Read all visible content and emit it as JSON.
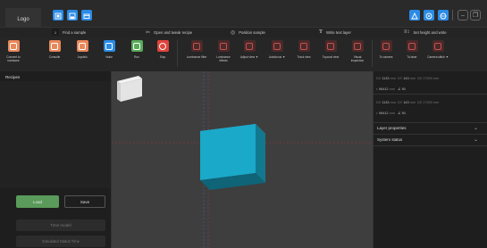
{
  "titlebar": {
    "logo": "Logo",
    "window_controls": [
      "–",
      "❐",
      "✕"
    ]
  },
  "workflow": {
    "steps": [
      {
        "num": "1",
        "label": "Find a sample"
      },
      {
        "num": "",
        "label": "Open and tweak recipe"
      },
      {
        "num": "",
        "label": "Position sample"
      },
      {
        "num": "",
        "label": "Write text layer"
      },
      {
        "num": "",
        "label": "Set height and write"
      }
    ]
  },
  "toolbar": {
    "tools": [
      {
        "label": "Connect to\nhardware",
        "color": "#e8875a"
      },
      {
        "label": "Consolle",
        "color": "#e8875a"
      },
      {
        "label": "Joystick",
        "color": "#e8875a"
      },
      {
        "label": "Value",
        "color": "#2b8be6"
      },
      {
        "label": "Run",
        "color": "#5aaa5a"
      },
      {
        "label": "Stop",
        "color": "#e0453c"
      },
      {
        "label": "Luminance filter",
        "color": ""
      },
      {
        "label": "Luminance\neffects",
        "color": ""
      },
      {
        "label": "Adjust view ▼",
        "color": ""
      },
      {
        "label": "Autofocus ▼",
        "color": ""
      },
      {
        "label": "Track view",
        "color": ""
      },
      {
        "label": "Topcoat view",
        "color": ""
      },
      {
        "label": "Visual\ninspection",
        "color": ""
      },
      {
        "label": "To camera",
        "color": ""
      },
      {
        "label": "To laser",
        "color": ""
      },
      {
        "label": "Camera stitch ▼",
        "color": ""
      }
    ]
  },
  "left": {
    "recipes_label": "Recipes",
    "load": "Load",
    "save": "Save",
    "time_btn": "Time model",
    "status_btn": "Simulated Status Time"
  },
  "right": {
    "coords1": {
      "x_label": "DX",
      "x": "1133",
      "y_label": "DY",
      "y": "143",
      "z_label": "DZ",
      "z": "17900",
      "unit": "mm"
    },
    "coords1b": {
      "val": "96412",
      "unit": "mm",
      "angle": "90"
    },
    "coords2": {
      "x_label": "DX",
      "x": "1133",
      "y_label": "DY",
      "y": "143",
      "z_label": "DZ",
      "z": "17900",
      "unit": "mm"
    },
    "coords2b": {
      "val": "96412",
      "unit": "mm",
      "angle": "90"
    },
    "layer_properties": "Layer properties",
    "system_status": "System status"
  },
  "colors": {
    "accent": "#2b8be6",
    "cube_front": "#1aa9c9",
    "cube_top": "#46c4dd",
    "cube_side": "#12788f",
    "guide_red": "#c23838",
    "guide_blue": "#4a6fc8"
  }
}
